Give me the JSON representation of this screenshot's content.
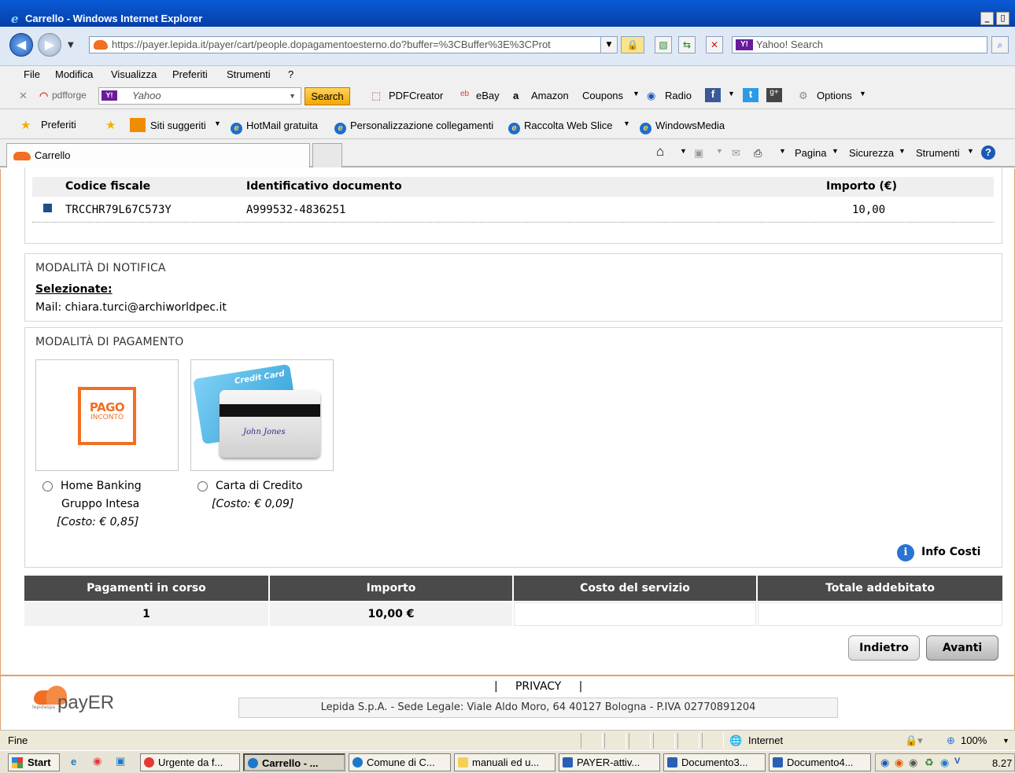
{
  "window": {
    "title": "Carrello - Windows Internet Explorer",
    "min_label": "_",
    "restore_label": "▯"
  },
  "address_bar": {
    "url": "https://payer.lepida.it/payer/cart/people.dopagamentoesterno.do?buffer=%3CBuffer%3E%3CProt",
    "search_placeholder": "Yahoo! Search"
  },
  "menu": [
    "File",
    "Modifica",
    "Visualizza",
    "Preferiti",
    "Strumenti",
    "?"
  ],
  "toolbar": {
    "brand": "pdfforge",
    "search_value": "Yahoo",
    "search_button": "Search",
    "items": [
      "PDFCreator",
      "eBay",
      "Amazon",
      "Coupons",
      "Radio",
      "Options"
    ]
  },
  "favorites": {
    "label": "Preferiti",
    "items": [
      "Siti suggeriti",
      "HotMail gratuita",
      "Personalizzazione collegamenti",
      "Raccolta Web Slice",
      "WindowsMedia"
    ]
  },
  "tabbar": {
    "tab_label": "Carrello",
    "commands": [
      "Pagina",
      "Sicurezza",
      "Strumenti"
    ]
  },
  "documents": {
    "headers": [
      "Codice fiscale",
      "Identificativo documento",
      "Importo (€)"
    ],
    "rows": [
      {
        "codice": "TRCCHR79L67C573Y",
        "id": "A999532-4836251",
        "importo": "10,00"
      }
    ]
  },
  "notifica": {
    "title": "MODALITÀ DI NOTIFICA",
    "selected_label": "Selezionate:",
    "mail_line": "Mail: chiara.turci@archiworldpec.it"
  },
  "pagamento": {
    "title": "MODALITÀ DI PAGAMENTO",
    "options": [
      {
        "line1": "Home Banking",
        "line2": "Gruppo Intesa",
        "cost": "[Costo: € 0,85]",
        "logo_top": "PAGO",
        "logo_bottom": "INCONTO"
      },
      {
        "line1": "Carta di Credito",
        "cost": "[Costo: € 0,09]",
        "card_title": "Credit Card",
        "card_signature": "John Jones"
      }
    ],
    "info_costi": "Info Costi"
  },
  "summary": {
    "headers": [
      "Pagamenti in corso",
      "Importo",
      "Costo del servizio",
      "Totale addebitato"
    ],
    "values": [
      "1",
      "10,00 €",
      "",
      ""
    ]
  },
  "buttons": {
    "back": "Indietro",
    "next": "Avanti"
  },
  "footer": {
    "privacy": "|     PRIVACY     |",
    "legal": "Lepida S.p.A. - Sede Legale: Viale Aldo Moro, 64 40127 Bologna - P.IVA 02770891204",
    "brand": "payER",
    "brand_small": "lepidaspa"
  },
  "status": {
    "text": "Fine",
    "zone": "Internet",
    "zoom": "100%"
  },
  "taskbar": {
    "start": "Start",
    "tasks": [
      "Urgente da f...",
      "Carrello - ...",
      "Comune di C...",
      "manuali ed u...",
      "PAYER-attiv...",
      "Documento3...",
      "Documento4..."
    ],
    "clock": "8.27"
  },
  "colors": {
    "accent": "#f26e22",
    "header_dark": "#4a4a4a",
    "title_bar": "#0a5ad7"
  }
}
